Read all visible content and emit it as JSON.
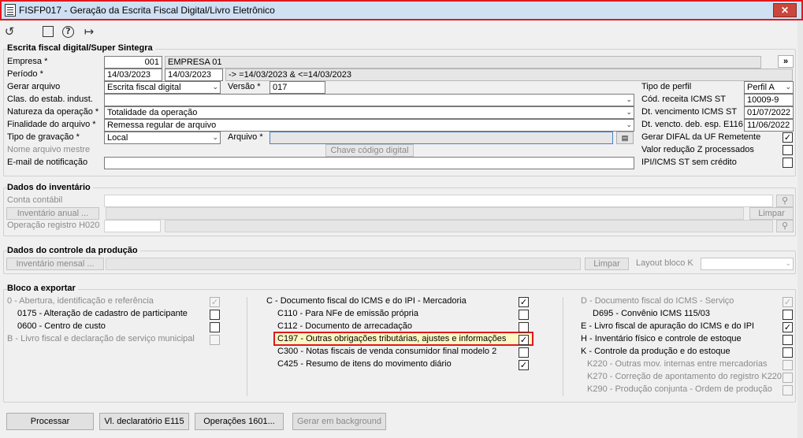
{
  "window": {
    "title": "FISFP017 - Geração da Escrita Fiscal Digital/Livro Eletrônico",
    "close": "✕"
  },
  "toolbar": {
    "undo": "↺",
    "calendar": "▦",
    "help": "?",
    "exit": "↦"
  },
  "efd": {
    "title": "Escrita fiscal digital/Super Sintegra",
    "empresa_label": "Empresa *",
    "empresa_code": "001",
    "empresa_name": "EMPRESA 01",
    "more": "»",
    "periodo_label": "Período *",
    "periodo_ini": "14/03/2023",
    "periodo_fim": "14/03/2023",
    "periodo_filter": "-> =14/03/2023 & <=14/03/2023",
    "gerar_label": "Gerar arquivo",
    "gerar_value": "Escrita fiscal digital",
    "versao_label": "Versão *",
    "versao_value": "017",
    "clas_label": "Clas. do estab. indust.",
    "clas_value": "",
    "natureza_label": "Natureza da operação *",
    "natureza_value": "Totalidade da operação",
    "finalidade_label": "Finalidade do arquivo *",
    "finalidade_value": "Remessa regular de arquivo",
    "tipo_grav_label": "Tipo de gravação *",
    "tipo_grav_value": "Local",
    "arquivo_label": "Arquivo *",
    "arquivo_value": "",
    "nome_label": "Nome arquivo mestre",
    "chave_label": "Chave código digital",
    "email_label": "E-mail de notificação",
    "email_value": "",
    "tipo_perfil_label": "Tipo de perfil",
    "tipo_perfil_value": "Perfil A",
    "cod_receita_label": "Cód. receita ICMS ST",
    "cod_receita_value": "10009-9",
    "dt_venc_label": "Dt. vencimento ICMS ST",
    "dt_venc_value": "01/07/2022",
    "dt_vencto_label": "Dt. vencto. deb. esp. E116",
    "dt_vencto_value": "11/06/2022",
    "difal_label": "Gerar DIFAL da UF Remetente",
    "difal_checked": "✓",
    "valor_red_label": "Valor redução Z processados",
    "valor_red_checked": "",
    "ipi_label": "IPI/ICMS ST sem crédito",
    "ipi_checked": ""
  },
  "inventario": {
    "title": "Dados do inventário",
    "conta_label": "Conta contábil",
    "inv_anual": "Inventário anual ...",
    "limpar": "Limpar",
    "op_label": "Operação registro H020"
  },
  "producao": {
    "title": "Dados do controle da produção",
    "inv_mensal": "Inventário mensal ...",
    "limpar": "Limpar",
    "layout_label": "Layout bloco K",
    "layout_value": ""
  },
  "bloco": {
    "title": "Bloco a exportar",
    "col1": [
      {
        "label": "0 - Abertura, identificação e referência",
        "check": "✓",
        "disabled": true
      },
      {
        "label": "0175 - Alteração de cadastro de participante",
        "check": "",
        "disabled": false
      },
      {
        "label": "0600 - Centro de custo",
        "check": "",
        "disabled": false
      },
      {
        "label": "B - Livro fiscal e declaração de serviço municipal",
        "check": "",
        "disabled": true
      }
    ],
    "col2": [
      {
        "label": "C - Documento fiscal do ICMS e do IPI - Mercadoria",
        "check": "✓"
      },
      {
        "label": "C110 - Para NFe de emissão própria",
        "check": ""
      },
      {
        "label": "C112 - Documento de arrecadação",
        "check": ""
      },
      {
        "label": "C197 - Outras obrigações tributárias, ajustes e informações",
        "check": "✓"
      },
      {
        "label": "C300 - Notas fiscais de venda consumidor final modelo 2",
        "check": ""
      },
      {
        "label": "C425 - Resumo de itens do movimento diário",
        "check": "✓"
      }
    ],
    "col3": [
      {
        "label": "D - Documento fiscal do ICMS - Serviço",
        "check": "✓",
        "disabled": true
      },
      {
        "label": "D695 - Convênio ICMS 115/03",
        "check": "",
        "disabled": false
      },
      {
        "label": "E - Livro fiscal de apuração do ICMS e do IPI",
        "check": "✓",
        "disabled": false
      },
      {
        "label": "H - Inventário físico e controle de estoque",
        "check": "",
        "disabled": false
      },
      {
        "label": "K - Controle da produção e do estoque",
        "check": "",
        "disabled": false
      },
      {
        "label": "K220 - Outras mov. internas entre mercadorias",
        "check": "",
        "disabled": true
      },
      {
        "label": "K270 - Correção de apontamento do registro K220",
        "check": "",
        "disabled": true
      },
      {
        "label": "K290 - Produção conjunta - Ordem de produção",
        "check": "",
        "disabled": true
      }
    ]
  },
  "footer": {
    "processar": "Processar",
    "vl_decl": "Vl. declaratório E115",
    "operacoes": "Operações 1601...",
    "gerar_bg": "Gerar em background"
  }
}
